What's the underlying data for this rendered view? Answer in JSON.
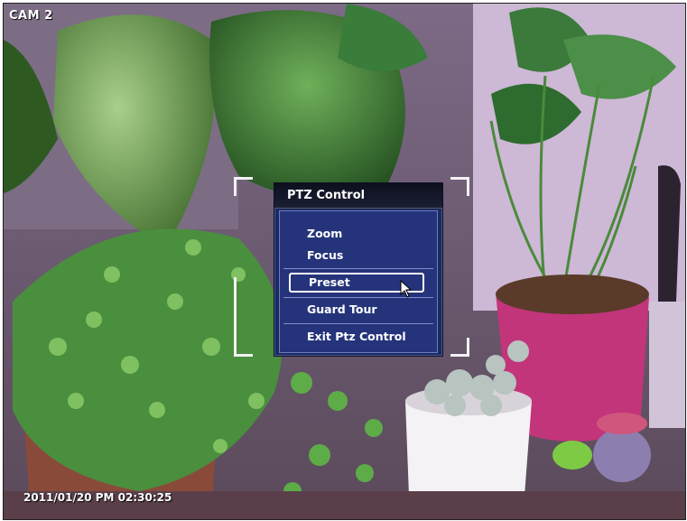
{
  "camera": {
    "label": "CAM 2"
  },
  "overlay": {
    "timestamp": "2011/01/20 PM 02:30:25"
  },
  "ptz_menu": {
    "title": "PTZ Control",
    "items": [
      {
        "label": "Zoom"
      },
      {
        "label": "Focus"
      },
      {
        "label": "Preset",
        "selected": true
      },
      {
        "label": "Guard Tour"
      },
      {
        "label": "Exit Ptz Control"
      }
    ]
  },
  "icons": {
    "cursor": "mouse-pointer-icon"
  },
  "colors": {
    "menu_bg": "#25347a",
    "menu_title_bg": "#0c0f1d",
    "highlight_border": "#ffffff"
  }
}
